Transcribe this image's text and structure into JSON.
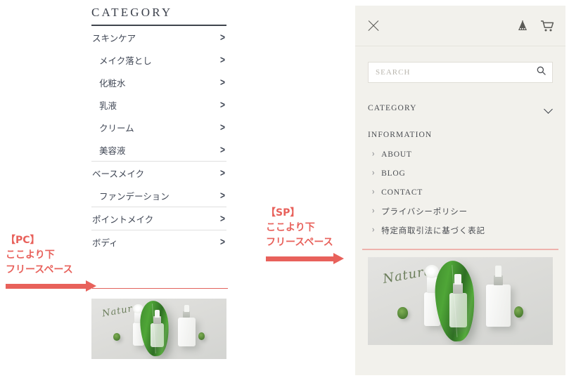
{
  "pc": {
    "heading": "CATEGORY",
    "items": [
      {
        "label": "スキンケア",
        "level": 1,
        "chevron": ">",
        "rule_after": false
      },
      {
        "label": "メイク落とし",
        "level": 2,
        "chevron": ">",
        "rule_after": false
      },
      {
        "label": "化粧水",
        "level": 2,
        "chevron": ">",
        "rule_after": false
      },
      {
        "label": "乳液",
        "level": 2,
        "chevron": ">",
        "rule_after": false
      },
      {
        "label": "クリーム",
        "level": 2,
        "chevron": ">",
        "rule_after": false
      },
      {
        "label": "美容液",
        "level": 2,
        "chevron": ">",
        "rule_after": true
      },
      {
        "label": "ベースメイク",
        "level": 1,
        "chevron": ">",
        "rule_after": false
      },
      {
        "label": "ファンデーション",
        "level": 2,
        "chevron": ">",
        "rule_after": true
      },
      {
        "label": "ポイントメイク",
        "level": 1,
        "chevron": ">",
        "rule_after": true
      },
      {
        "label": "ボディ",
        "level": 1,
        "chevron": ">",
        "rule_after": false
      }
    ],
    "banner": {
      "wordmark": "Natura",
      "wordmark_size": "13px"
    }
  },
  "annotations": {
    "pc": {
      "tag": "【PC】",
      "line2": "ここより下",
      "line3": "フリースペース"
    },
    "sp": {
      "tag": "【SP】",
      "line2": "ここより下",
      "line3": "フリースペース"
    }
  },
  "sp": {
    "close_icon": "close-icon",
    "header_icons": [
      "member-icon",
      "cart-icon"
    ],
    "search": {
      "placeholder": "SEARCH",
      "value": "",
      "icon": "search-icon"
    },
    "category": {
      "label": "CATEGORY",
      "icon": "chevron-down-icon"
    },
    "information": {
      "title": "INFORMATION",
      "items": [
        "ABOUT",
        "BLOG",
        "CONTACT",
        "プライバシーポリシー",
        "特定商取引法に基づく表記"
      ]
    },
    "banner": {
      "wordmark": "Natura",
      "wordmark_size": "18px"
    }
  },
  "colors": {
    "accent_red": "#e8615b",
    "pc_divider_red": "#e2625c",
    "sp_divider_pink": "#eeb3ad",
    "sp_background": "#f2f1ec",
    "text_dark": "#3f444d"
  }
}
